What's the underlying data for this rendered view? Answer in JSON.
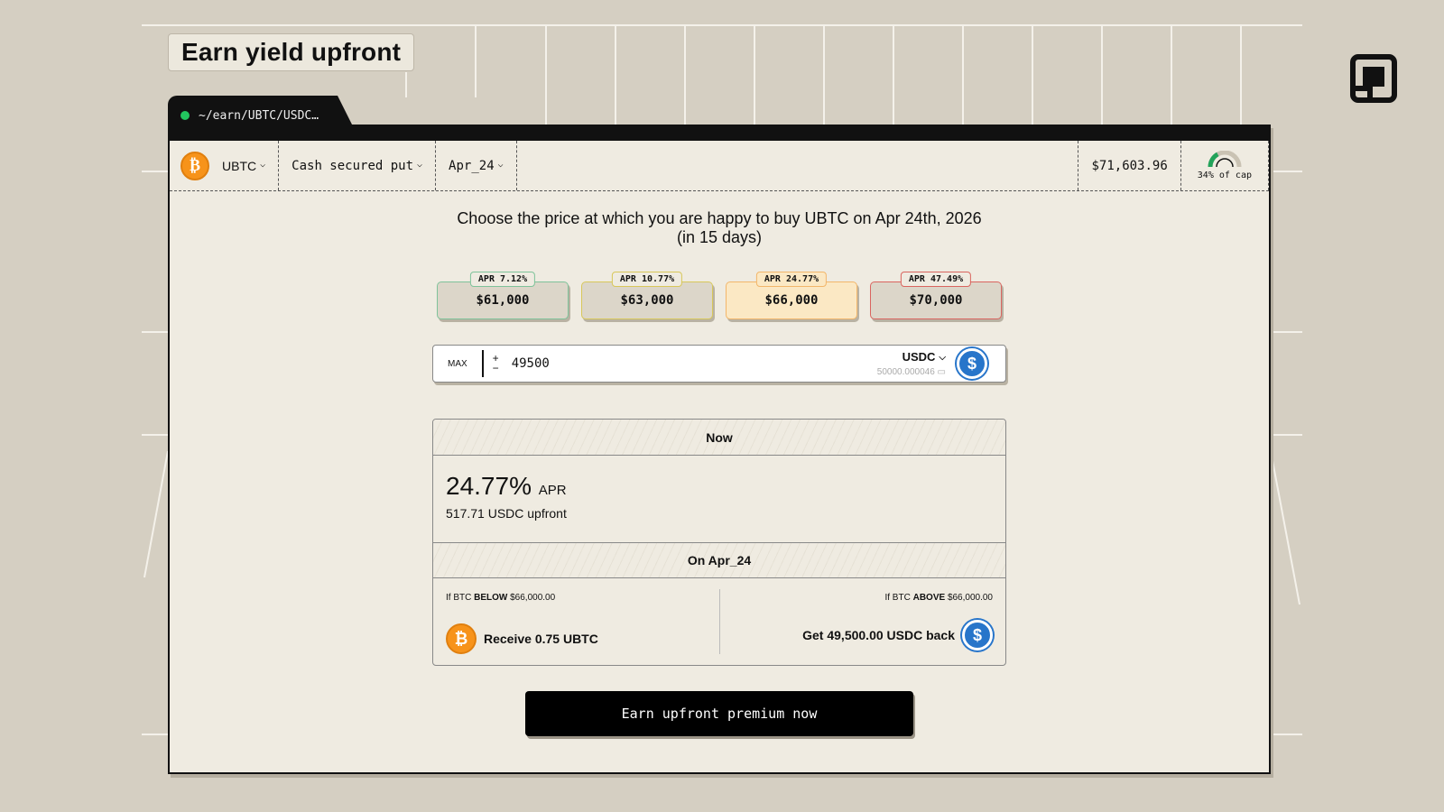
{
  "page_title": "Earn yield upfront",
  "window_tab": {
    "path": "~/earn/UBTC/USDC…",
    "status_color": "#22c55e"
  },
  "toolbar": {
    "asset": "UBTC",
    "strategy": "Cash secured put",
    "expiry": "Apr_24",
    "price": "$71,603.96",
    "cap_label": "34% of cap",
    "cap_fraction": 0.34,
    "chevron": "⌵"
  },
  "prompt": {
    "line1": "Choose the price at which you are happy to buy UBTC on Apr 24th, 2026",
    "line2": "(in 15 days)"
  },
  "strikes": [
    {
      "apr_label": "APR",
      "apr": "7.12%",
      "price": "$61,000",
      "color": "#7fc39a"
    },
    {
      "apr_label": "APR",
      "apr": "10.77%",
      "price": "$63,000",
      "color": "#d8c75a"
    },
    {
      "apr_label": "APR",
      "apr": "24.77%",
      "price": "$66,000",
      "color": "#f2b66a",
      "selected": true
    },
    {
      "apr_label": "APR",
      "apr": "47.49%",
      "price": "$70,000",
      "color": "#d9655f"
    }
  ],
  "amount": {
    "max_label": "MAX",
    "plus": "+",
    "minus": "−",
    "value": "49500",
    "token": "USDC",
    "balance": "50000.000046"
  },
  "summary": {
    "now_header": "Now",
    "apr_value": "24.77%",
    "apr_label": "APR",
    "upfront": "517.71 USDC upfront",
    "on_header": "On Apr_24",
    "below": {
      "prefix": "If BTC",
      "keyword": "BELOW",
      "price": "$66,000.00",
      "result": "Receive 0.75 UBTC"
    },
    "above": {
      "prefix": "If BTC",
      "keyword": "ABOVE",
      "price": "$66,000.00",
      "result": "Get 49,500.00 USDC back"
    }
  },
  "cta_label": "Earn upfront premium now",
  "icons": {
    "btc": "₿",
    "usdc": "$"
  }
}
